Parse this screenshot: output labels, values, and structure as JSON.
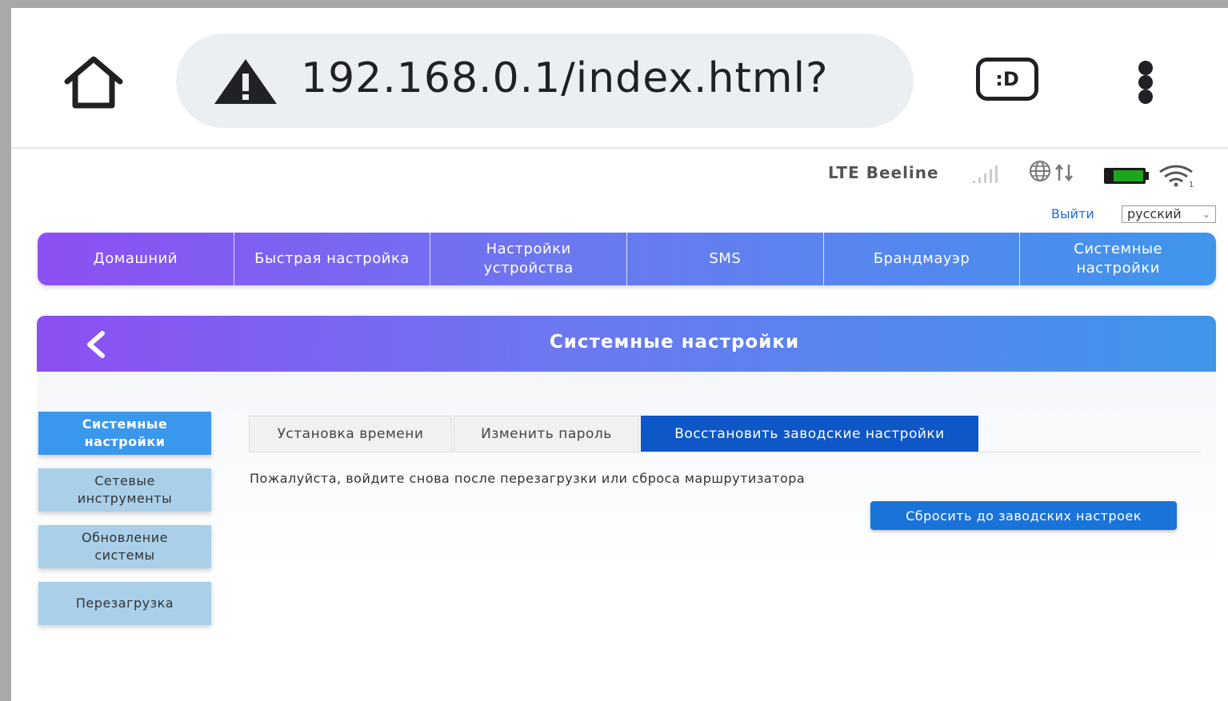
{
  "browser": {
    "url": "192.168.0.1/index.html?",
    "tab_switcher_label": ":D",
    "icons": {
      "home": "home-icon",
      "warning": "warning-triangle-icon",
      "menu": "kebab-menu-icon"
    }
  },
  "status": {
    "network": "LTE  Beeline",
    "wifi_clients": "1",
    "icons": [
      "signal-bars-icon",
      "globe-data-icon",
      "battery-icon",
      "wifi-icon"
    ],
    "battery_color": "#1ea51e"
  },
  "header": {
    "logout": "Выйти",
    "language": "русский"
  },
  "topnav": {
    "items": [
      {
        "label": "Домашний"
      },
      {
        "label": "Быстрая настройка"
      },
      {
        "label": "Настройки\nустройства"
      },
      {
        "label": "SMS"
      },
      {
        "label": "Брандмауэр"
      },
      {
        "label": "Системные\nнастройки"
      }
    ]
  },
  "page": {
    "title": "Системные настройки",
    "back_icon": "chevron-left-icon"
  },
  "sidebar": {
    "items": [
      {
        "label": "Системные\nнастройки",
        "active": true
      },
      {
        "label": "Сетевые\nинструменты",
        "active": false
      },
      {
        "label": "Обновление\nсистемы",
        "active": false
      },
      {
        "label": "Перезагрузка",
        "active": false
      }
    ]
  },
  "tabs": {
    "items": [
      {
        "label": "Установка времени",
        "active": false
      },
      {
        "label": "Изменить пароль",
        "active": false
      },
      {
        "label": "Восстановить заводские настройки",
        "active": true
      }
    ]
  },
  "main": {
    "notice": "Пожалуйста, войдите снова после перезагрузки или сброса маршрутизатора",
    "reset_button": "Сбросить до заводских настроек"
  },
  "colors": {
    "nav_gradient_start": "#8d4ff3",
    "nav_gradient_end": "#3f95ec",
    "active_tab": "#0f57c7",
    "button": "#1a73d9",
    "sidebar_item": "#a9cfe9",
    "sidebar_active": "#3a97ee"
  }
}
